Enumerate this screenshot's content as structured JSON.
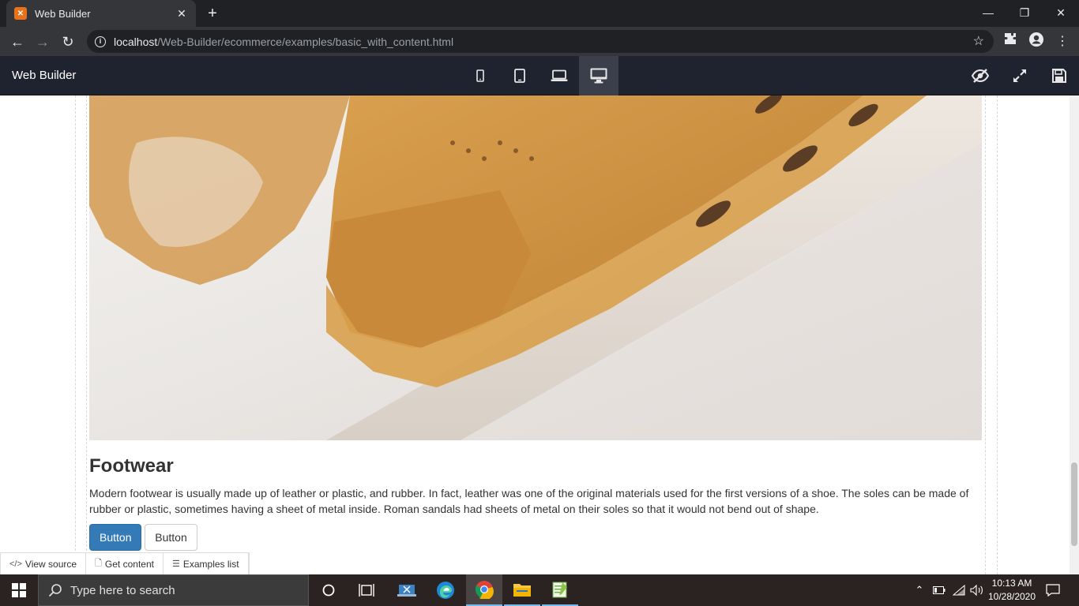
{
  "browser": {
    "tab_title": "Web Builder",
    "url_host": "localhost",
    "url_path": "/Web-Builder/ecommerce/examples/basic_with_content.html"
  },
  "app": {
    "brand": "Web Builder",
    "device_buttons": [
      "mobile-icon",
      "tablet-icon",
      "laptop-icon",
      "desktop-icon"
    ],
    "active_device": "desktop"
  },
  "content": {
    "heading": "Footwear",
    "paragraph": "Modern footwear is usually made up of leather or plastic, and rubber. In fact, leather was one of the original materials used for the first versions of a shoe. The soles can be made of rubber or plastic, sometimes having a sheet of metal inside. Roman sandals had sheets of metal on their soles so that it would not bend out of shape.",
    "button_primary": "Button",
    "button_default": "Button"
  },
  "bottom_bar": {
    "view_source": "View source",
    "get_content": "Get content",
    "examples_list": "Examples list"
  },
  "taskbar": {
    "search_placeholder": "Type here to search",
    "time": "10:13 AM",
    "date": "10/28/2020"
  },
  "colors": {
    "primary_button": "#337ab7",
    "app_bar": "#1f2330",
    "taskbar": "#2b2222"
  }
}
